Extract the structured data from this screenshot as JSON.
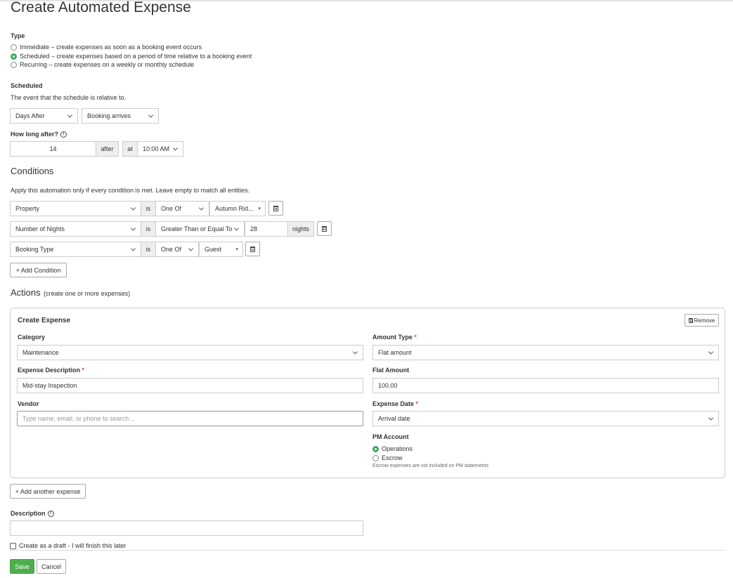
{
  "page_title": "Create Automated Expense",
  "type": {
    "label": "Type",
    "options": [
      {
        "label": "Immediate – create expenses as soon as a booking event occurs",
        "selected": false
      },
      {
        "label": "Scheduled – create expenses based on a period of time relative to a booking event",
        "selected": true
      },
      {
        "label": "Recurring – create expenses on a weekly or monthly schedule",
        "selected": false
      }
    ]
  },
  "scheduled": {
    "heading": "Scheduled",
    "help": "The event that the schedule is relative to.",
    "relation": "Days After",
    "event": "Booking arrives",
    "how_long_label": "How long after?",
    "amount": "14",
    "after_label": "after",
    "at_label": "at",
    "time": "10:00 AM"
  },
  "conditions": {
    "heading": "Conditions",
    "help": "Apply this automation only if every condition is met. Leave empty to match all entities.",
    "rows": [
      {
        "field": "Property",
        "is": "is",
        "operator": "One Of",
        "value": "Autumn Rid..."
      },
      {
        "field": "Number of Nights",
        "is": "is",
        "operator": "Greater Than or Equal To",
        "value": "28",
        "unit": "nights"
      },
      {
        "field": "Booking Type",
        "is": "is",
        "operator": "One Of",
        "value": "Guest"
      }
    ],
    "add_label": "+ Add Condition"
  },
  "actions": {
    "heading": "Actions",
    "subheading": "(create one or more expenses)",
    "expense": {
      "title": "Create Expense",
      "remove_label": "Remove",
      "category_label": "Category",
      "category": "Maintenance",
      "description_label": "Expense Description",
      "description": "Mid-stay Inspection",
      "vendor_label": "Vendor",
      "vendor_placeholder": "Type name, email, or phone to search...",
      "amount_type_label": "Amount Type",
      "amount_type": "Flat amount",
      "flat_amount_label": "Flat Amount",
      "flat_amount": "100.00",
      "expense_date_label": "Expense Date",
      "expense_date": "Arrival date",
      "pm_account_label": "PM Account",
      "pm_options": [
        {
          "label": "Operations",
          "selected": true
        },
        {
          "label": "Escrow",
          "selected": false
        }
      ],
      "escrow_note": "Escrow expenses are not included on PM statements"
    },
    "add_another_label": "+ Add another expense"
  },
  "description": {
    "label": "Description",
    "value": ""
  },
  "draft_label": "Create as a draft - I will finish this later",
  "buttons": {
    "save": "Save",
    "cancel": "Cancel"
  },
  "colors": {
    "accent": "#4cae4c",
    "required": "#d9534f"
  }
}
